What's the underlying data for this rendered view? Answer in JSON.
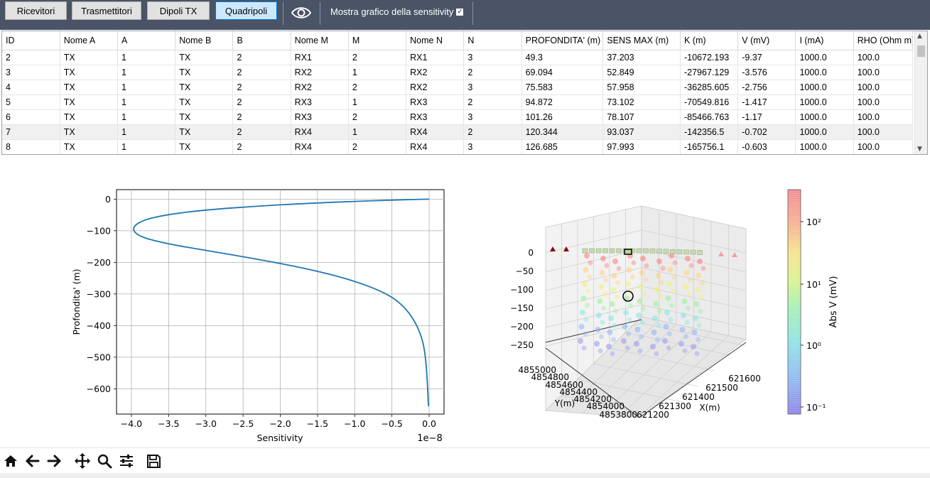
{
  "toolbar": {
    "buttons": [
      "Ricevitori",
      "Trasmettitori",
      "Dipoli TX",
      "Quadripoli"
    ],
    "active_button": "Quadripoli",
    "sensitivity_label": "Mostra grafico della sensitivity",
    "sensitivity_checked": true,
    "eye_icon": "eye-icon"
  },
  "table": {
    "columns": [
      "ID",
      "Nome A",
      "A",
      "Nome B",
      "B",
      "Nome M",
      "M",
      "Nome N",
      "N",
      "PROFONDITA' (m)",
      "SENS MAX (m)",
      "K (m)",
      "V (mV)",
      "I (mA)",
      "RHO (Ohm m)"
    ],
    "rows": [
      [
        "2",
        "TX",
        "1",
        "TX",
        "2",
        "RX1",
        "2",
        "RX1",
        "3",
        "49.3",
        "37.203",
        "-10672.193",
        "-9.37",
        "1000.0",
        "100.0"
      ],
      [
        "3",
        "TX",
        "1",
        "TX",
        "2",
        "RX2",
        "1",
        "RX2",
        "2",
        "69.094",
        "52.849",
        "-27967.129",
        "-3.576",
        "1000.0",
        "100.0"
      ],
      [
        "4",
        "TX",
        "1",
        "TX",
        "2",
        "RX2",
        "2",
        "RX2",
        "3",
        "75.583",
        "57.958",
        "-36285.605",
        "-2.756",
        "1000.0",
        "100.0"
      ],
      [
        "5",
        "TX",
        "1",
        "TX",
        "2",
        "RX3",
        "1",
        "RX3",
        "2",
        "94.872",
        "73.102",
        "-70549.816",
        "-1.417",
        "1000.0",
        "100.0"
      ],
      [
        "6",
        "TX",
        "1",
        "TX",
        "2",
        "RX3",
        "2",
        "RX3",
        "3",
        "101.26",
        "78.107",
        "-85466.763",
        "-1.17",
        "1000.0",
        "100.0"
      ],
      [
        "7",
        "TX",
        "1",
        "TX",
        "2",
        "RX4",
        "1",
        "RX4",
        "2",
        "120.344",
        "93.037",
        "-142356.5",
        "-0.702",
        "1000.0",
        "100.0"
      ],
      [
        "8",
        "TX",
        "1",
        "TX",
        "2",
        "RX4",
        "2",
        "RX4",
        "3",
        "126.685",
        "97.993",
        "-165756.1",
        "-0.603",
        "1000.0",
        "100.0"
      ]
    ],
    "selected_row_index": 5
  },
  "sensitivity_plot": {
    "xlabel": "Sensitivity",
    "ylabel": "Profondita' (m)",
    "x_ticks": [
      "−4.0",
      "−3.5",
      "−3.0",
      "−2.5",
      "−2.0",
      "−1.5",
      "−1.0",
      "−0.5",
      "0.0"
    ],
    "y_ticks": [
      "0",
      "−100",
      "−200",
      "−300",
      "−400",
      "−500",
      "−600"
    ],
    "offset_text": "1e−8",
    "line_color": "#1f77b4"
  },
  "chart_data": {
    "type": "line",
    "title": "",
    "xlabel": "Sensitivity",
    "ylabel": "Profondita' (m)",
    "x_scale": "1e-8",
    "xlim": [
      -4.2,
      0.2
    ],
    "ylim": [
      -680,
      30
    ],
    "grid": true,
    "series": [
      {
        "x": [
          0.0,
          -0.5,
          -1.0,
          -1.6,
          -2.3,
          -3.0,
          -3.5,
          -3.85,
          -4.0,
          -3.9,
          -3.55,
          -3.0,
          -2.3,
          -1.6,
          -1.05,
          -0.6,
          -0.35,
          -0.18,
          -0.08,
          -0.04,
          -0.02,
          -0.01
        ],
        "y": [
          0,
          -3,
          -7,
          -13,
          -22,
          -34,
          -48,
          -66,
          -92,
          -118,
          -140,
          -162,
          -190,
          -222,
          -255,
          -295,
          -335,
          -390,
          -450,
          -520,
          -600,
          -655
        ]
      }
    ]
  },
  "scatter3d": {
    "z_ticks": [
      "0",
      "−50",
      "−100",
      "−150",
      "−200",
      "−250"
    ],
    "y_ticks": [
      "4855000",
      "4854800",
      "4854600",
      "4854400",
      "4854200",
      "4854000",
      "4853800"
    ],
    "x_ticks": [
      "621200",
      "621300",
      "621400",
      "621500",
      "621600"
    ],
    "ylabel": "Y(m)",
    "xlabel": "X(m)"
  },
  "colorbar": {
    "label": "Abs V (mV)",
    "ticks": [
      "10²",
      "10¹",
      "10⁰",
      "10⁻¹"
    ]
  },
  "navbar": {
    "icons": [
      "home-icon",
      "back-icon",
      "forward-icon",
      "pan-icon",
      "zoom-icon",
      "configure-icon",
      "save-icon"
    ]
  }
}
